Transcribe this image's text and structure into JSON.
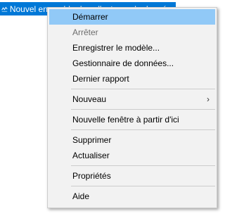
{
  "tree": {
    "selected_node_label": "Nouvel ensemble de collecteurs de données"
  },
  "menu": {
    "items": {
      "start": "Démarrer",
      "stop": "Arrêter",
      "save_template": "Enregistrer le modèle...",
      "data_manager": "Gestionnaire de données...",
      "latest_report": "Dernier rapport",
      "new": "Nouveau",
      "new_window": "Nouvelle fenêtre à partir d'ici",
      "delete": "Supprimer",
      "refresh": "Actualiser",
      "properties": "Propriétés",
      "help": "Aide"
    },
    "submenu_arrow": "›",
    "states": {
      "highlighted_item": "start",
      "disabled_items": [
        "stop"
      ]
    }
  },
  "colors": {
    "selection": "#0078d7",
    "menu_background": "#f2f2f2",
    "menu_highlight": "#91c9f7",
    "disabled_text": "#6d6d6d"
  }
}
